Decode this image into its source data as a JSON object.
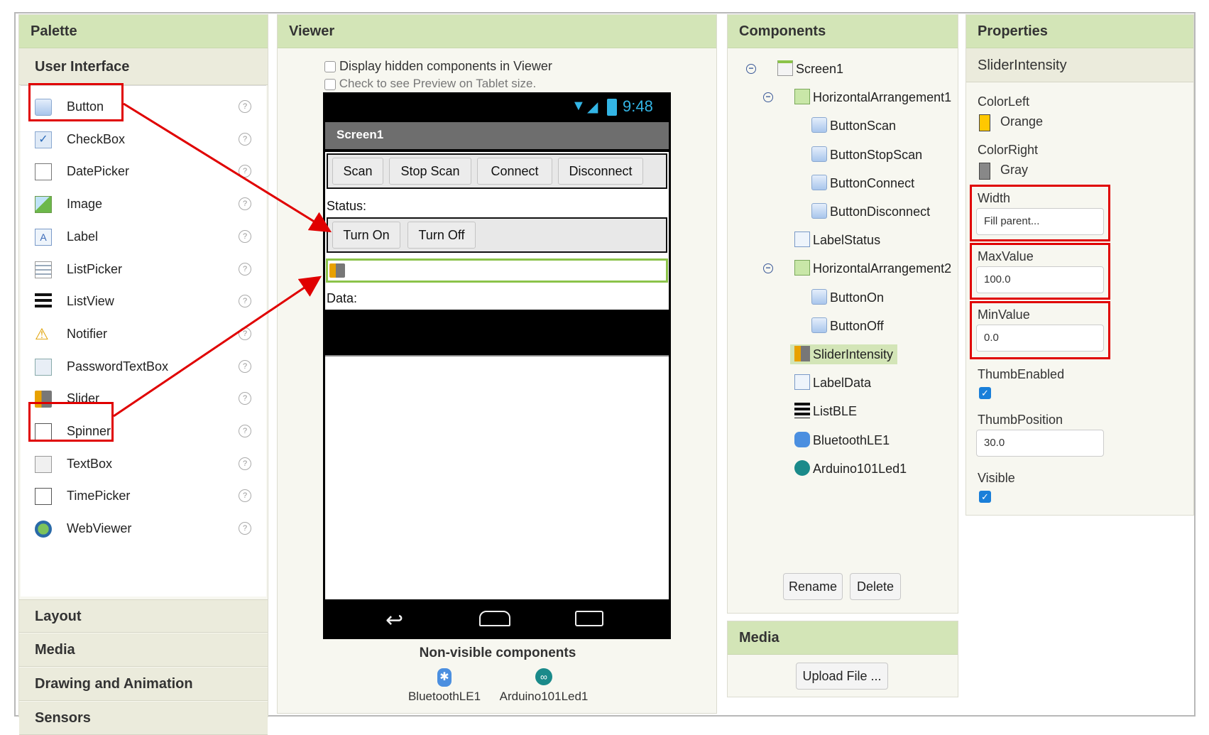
{
  "palette": {
    "title": "Palette",
    "section": "User Interface",
    "help_glyph": "?",
    "items": [
      {
        "label": "Button",
        "icon": "button-icon"
      },
      {
        "label": "CheckBox",
        "icon": "checkbox-icon"
      },
      {
        "label": "DatePicker",
        "icon": "datepicker-icon"
      },
      {
        "label": "Image",
        "icon": "image-icon"
      },
      {
        "label": "Label",
        "icon": "label-icon"
      },
      {
        "label": "ListPicker",
        "icon": "listpicker-icon"
      },
      {
        "label": "ListView",
        "icon": "listview-icon"
      },
      {
        "label": "Notifier",
        "icon": "notifier-icon"
      },
      {
        "label": "PasswordTextBox",
        "icon": "passwordtextbox-icon"
      },
      {
        "label": "Slider",
        "icon": "slider-icon"
      },
      {
        "label": "Spinner",
        "icon": "spinner-icon"
      },
      {
        "label": "TextBox",
        "icon": "textbox-icon"
      },
      {
        "label": "TimePicker",
        "icon": "timepicker-icon"
      },
      {
        "label": "WebViewer",
        "icon": "webviewer-icon"
      }
    ],
    "categories": [
      "Layout",
      "Media",
      "Drawing and Animation",
      "Sensors"
    ]
  },
  "viewer": {
    "title": "Viewer",
    "display_hidden": "Display hidden components in Viewer",
    "preview_tablet": "Check to see Preview on Tablet size.",
    "status_time": "9:48",
    "screen_title": "Screen1",
    "buttons_row1": [
      "Scan",
      "Stop Scan",
      "Connect",
      "Disconnect"
    ],
    "status_label": "Status:",
    "buttons_row2": [
      "Turn On",
      "Turn Off"
    ],
    "data_label": "Data:",
    "nonvisible_title": "Non-visible components",
    "nonvisible": [
      "BluetoothLE1",
      "Arduino101Led1"
    ]
  },
  "components": {
    "title": "Components",
    "tree": [
      {
        "label": "Screen1",
        "icon": "screen-icon",
        "toggle": "−"
      },
      {
        "label": "HorizontalArrangement1",
        "icon": "arrangement-icon",
        "toggle": "−"
      },
      {
        "label": "ButtonScan",
        "icon": "button-icon"
      },
      {
        "label": "ButtonStopScan",
        "icon": "button-icon"
      },
      {
        "label": "ButtonConnect",
        "icon": "button-icon"
      },
      {
        "label": "ButtonDisconnect",
        "icon": "button-icon"
      },
      {
        "label": "LabelStatus",
        "icon": "label-icon"
      },
      {
        "label": "HorizontalArrangement2",
        "icon": "arrangement-icon",
        "toggle": "−"
      },
      {
        "label": "ButtonOn",
        "icon": "button-icon"
      },
      {
        "label": "ButtonOff",
        "icon": "button-icon"
      },
      {
        "label": "SliderIntensity",
        "icon": "slider-icon",
        "selected": true
      },
      {
        "label": "LabelData",
        "icon": "label-icon"
      },
      {
        "label": "ListBLE",
        "icon": "listview-icon"
      },
      {
        "label": "BluetoothLE1",
        "icon": "bluetooth-icon"
      },
      {
        "label": "Arduino101Led1",
        "icon": "arduino-icon"
      }
    ],
    "rename": "Rename",
    "delete": "Delete"
  },
  "media": {
    "title": "Media",
    "upload": "Upload File ..."
  },
  "properties": {
    "title": "Properties",
    "component": "SliderIntensity",
    "color_left_label": "ColorLeft",
    "color_left_value": "Orange",
    "color_left_hex": "#ffc800",
    "color_right_label": "ColorRight",
    "color_right_value": "Gray",
    "color_right_hex": "#888888",
    "width_label": "Width",
    "width_value": "Fill parent...",
    "max_label": "MaxValue",
    "max_value": "100.0",
    "min_label": "MinValue",
    "min_value": "0.0",
    "thumb_enabled_label": "ThumbEnabled",
    "thumb_enabled": true,
    "thumb_position_label": "ThumbPosition",
    "thumb_position_value": "30.0",
    "visible_label": "Visible",
    "visible": true
  }
}
